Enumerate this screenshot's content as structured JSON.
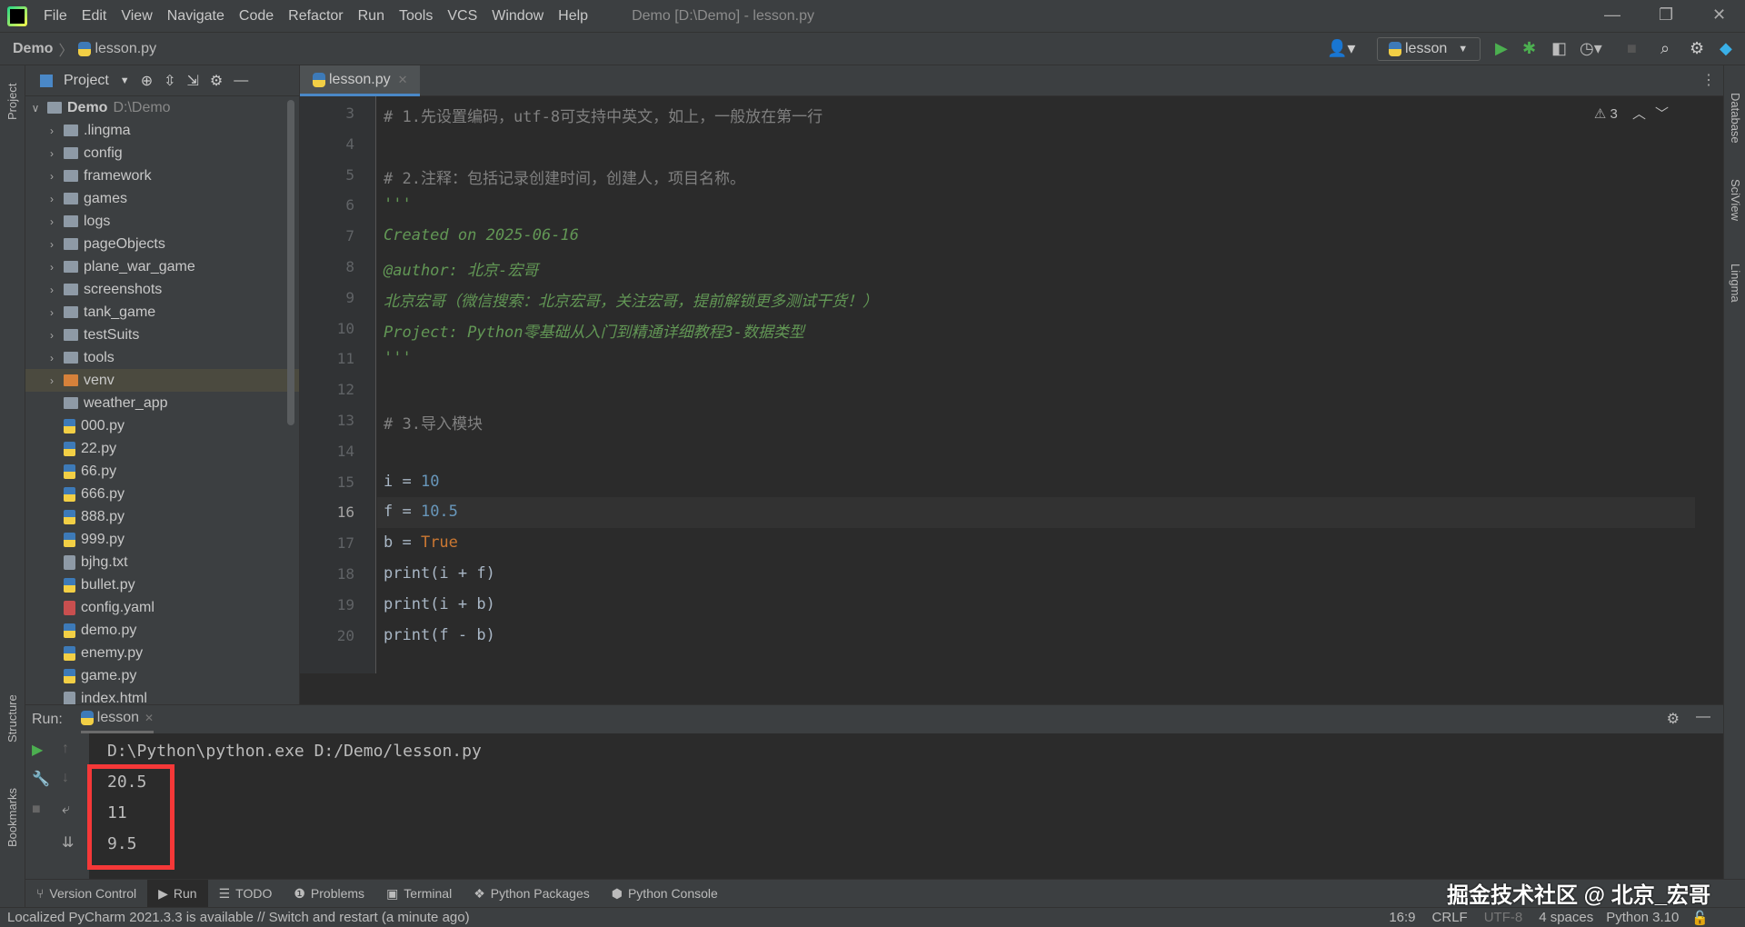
{
  "menu": {
    "items": [
      "File",
      "Edit",
      "View",
      "Navigate",
      "Code",
      "Refactor",
      "Run",
      "Tools",
      "VCS",
      "Window",
      "Help"
    ],
    "window_title": "Demo [D:\\Demo] - lesson.py"
  },
  "nav": {
    "breadcrumb": [
      "Demo",
      "lesson.py"
    ],
    "run_config": "lesson"
  },
  "project": {
    "title": "Project",
    "root": {
      "name": "Demo",
      "path": "D:\\Demo"
    },
    "items": [
      {
        "name": ".lingma",
        "type": "folder"
      },
      {
        "name": "config",
        "type": "folder"
      },
      {
        "name": "framework",
        "type": "folder"
      },
      {
        "name": "games",
        "type": "folder"
      },
      {
        "name": "logs",
        "type": "folder"
      },
      {
        "name": "pageObjects",
        "type": "folder"
      },
      {
        "name": "plane_war_game",
        "type": "folder"
      },
      {
        "name": "screenshots",
        "type": "folder"
      },
      {
        "name": "tank_game",
        "type": "folder"
      },
      {
        "name": "testSuits",
        "type": "folder"
      },
      {
        "name": "tools",
        "type": "folder"
      },
      {
        "name": "venv",
        "type": "folder-excluded",
        "selected": true
      },
      {
        "name": "weather_app",
        "type": "folder-noarrow"
      },
      {
        "name": "000.py",
        "type": "py"
      },
      {
        "name": "22.py",
        "type": "py"
      },
      {
        "name": "66.py",
        "type": "py"
      },
      {
        "name": "666.py",
        "type": "py"
      },
      {
        "name": "888.py",
        "type": "py"
      },
      {
        "name": "999.py",
        "type": "py"
      },
      {
        "name": "bjhg.txt",
        "type": "txt"
      },
      {
        "name": "bullet.py",
        "type": "py"
      },
      {
        "name": "config.yaml",
        "type": "yaml"
      },
      {
        "name": "demo.py",
        "type": "py"
      },
      {
        "name": "enemy.py",
        "type": "py"
      },
      {
        "name": "game.py",
        "type": "py"
      },
      {
        "name": "index.html",
        "type": "html"
      }
    ]
  },
  "editor": {
    "tab": "lesson.py",
    "warnings": "3",
    "current_line": 16,
    "lines": [
      {
        "n": "3",
        "t": "# 1.先设置编码，utf-8可支持中英文，如上，一般放在第一行",
        "c": "cm"
      },
      {
        "n": "4",
        "t": "",
        "c": ""
      },
      {
        "n": "5",
        "t": "# 2.注释：包括记录创建时间，创建人，项目名称。",
        "c": "cm"
      },
      {
        "n": "6",
        "t": "'''",
        "c": "doc"
      },
      {
        "n": "7",
        "t": "Created on 2025-06-16",
        "c": "doc"
      },
      {
        "n": "8",
        "t": "@author: 北京-宏哥",
        "c": "doc"
      },
      {
        "n": "9",
        "t": "北京宏哥（微信搜索：北京宏哥，关注宏哥，提前解锁更多测试干货！）",
        "c": "doc"
      },
      {
        "n": "10",
        "t": "Project: Python零基础从入门到精通详细教程3-数据类型",
        "c": "doc"
      },
      {
        "n": "11",
        "t": "'''",
        "c": "doc"
      },
      {
        "n": "12",
        "t": "",
        "c": ""
      },
      {
        "n": "13",
        "t": "# 3.导入模块",
        "c": "cm"
      },
      {
        "n": "14",
        "t": "",
        "c": ""
      },
      {
        "n": "15",
        "t": "i = ",
        "v": "10",
        "vc": "num"
      },
      {
        "n": "16",
        "t": "f = ",
        "v": "10.5",
        "vc": "num"
      },
      {
        "n": "17",
        "t": "b = ",
        "v": "True",
        "vc": "kw"
      },
      {
        "n": "18",
        "t": "print(i + f)",
        "c": ""
      },
      {
        "n": "19",
        "t": "print(i + b)",
        "c": ""
      },
      {
        "n": "20",
        "t": "print(f - b)",
        "c": ""
      }
    ]
  },
  "run": {
    "label": "Run:",
    "tab": "lesson",
    "command": "D:\\Python\\python.exe D:/Demo/lesson.py",
    "output": [
      "20.5",
      "11",
      "9.5"
    ]
  },
  "left_strip": {
    "project": "Project",
    "structure": "Structure",
    "bookmarks": "Bookmarks"
  },
  "right_strip": [
    "Database",
    "SciView",
    "Lingma"
  ],
  "bottom_tools": [
    "Version Control",
    "Run",
    "TODO",
    "Problems",
    "Terminal",
    "Python Packages",
    "Python Console"
  ],
  "status": {
    "message": "Localized PyCharm 2021.3.3 is available // Switch and restart (a minute ago)",
    "position": "16:9",
    "line_sep": "CRLF",
    "encoding": "UTF-8",
    "indent": "4 spaces",
    "interpreter": "Python 3.10"
  },
  "watermark": "掘金技术社区 @ 北京_宏哥",
  "colors": {
    "highlight_box": "#f53838",
    "accent": "#4a88c7",
    "docstring": "#629755"
  }
}
